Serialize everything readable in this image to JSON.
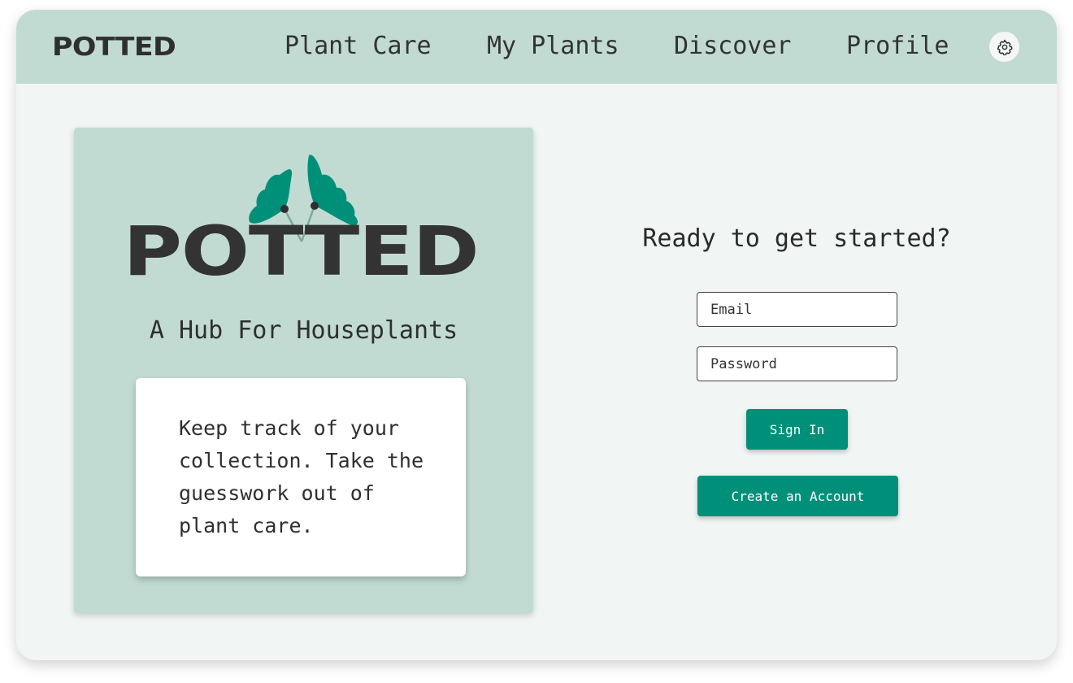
{
  "header": {
    "brand": "POTTED",
    "nav": [
      "Plant Care",
      "My Plants",
      "Discover",
      "Profile"
    ],
    "settings_icon": "gear-icon"
  },
  "hero": {
    "logo_text": "POTTED",
    "tagline": "A Hub For Houseplants",
    "description": "Keep track of your collection. Take the guesswork out of plant care."
  },
  "login": {
    "heading": "Ready to get started?",
    "email_placeholder": "Email",
    "password_placeholder": "Password",
    "sign_in_label": "Sign In",
    "create_account_label": "Create an Account"
  },
  "colors": {
    "accent": "#00907a",
    "panel": "#c1dbd3",
    "background": "#f1f5f4",
    "text": "#333333"
  }
}
